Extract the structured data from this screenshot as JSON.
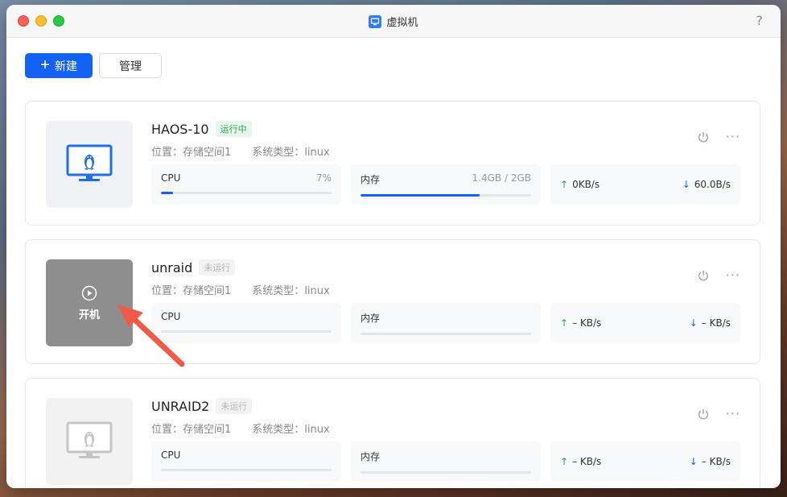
{
  "window": {
    "title": "虚拟机",
    "help": "?"
  },
  "toolbar": {
    "new_label": "新建",
    "manage_label": "管理"
  },
  "labels": {
    "location_prefix": "位置：",
    "os_prefix": "系统类型：",
    "cpu": "CPU",
    "memory": "内存"
  },
  "vms": [
    {
      "name": "HAOS-10",
      "status": "运行中",
      "location": "存储空间1",
      "os": "linux",
      "cpu_value": "7%",
      "cpu_fraction": 0.07,
      "mem_value": "1.4GB / 2GB",
      "mem_fraction": 0.7,
      "net_up": "0KB/s",
      "net_down": "60.0B/s"
    },
    {
      "name": "unraid",
      "status": "未运行",
      "location": "存储空间1",
      "os": "linux",
      "cpu_value": "",
      "cpu_fraction": 0,
      "mem_value": "",
      "mem_fraction": 0,
      "net_up": "– KB/s",
      "net_down": "– KB/s",
      "power_on_label": "开机"
    },
    {
      "name": "UNRAID2",
      "status": "未运行",
      "location": "存储空间1",
      "os": "linux",
      "cpu_value": "",
      "cpu_fraction": 0,
      "mem_value": "",
      "mem_fraction": 0,
      "net_up": "– KB/s",
      "net_down": "– KB/s"
    }
  ],
  "colors": {
    "accent": "#1462f5",
    "running": "#2ea44f",
    "annotation_arrow": "#f05a47"
  }
}
